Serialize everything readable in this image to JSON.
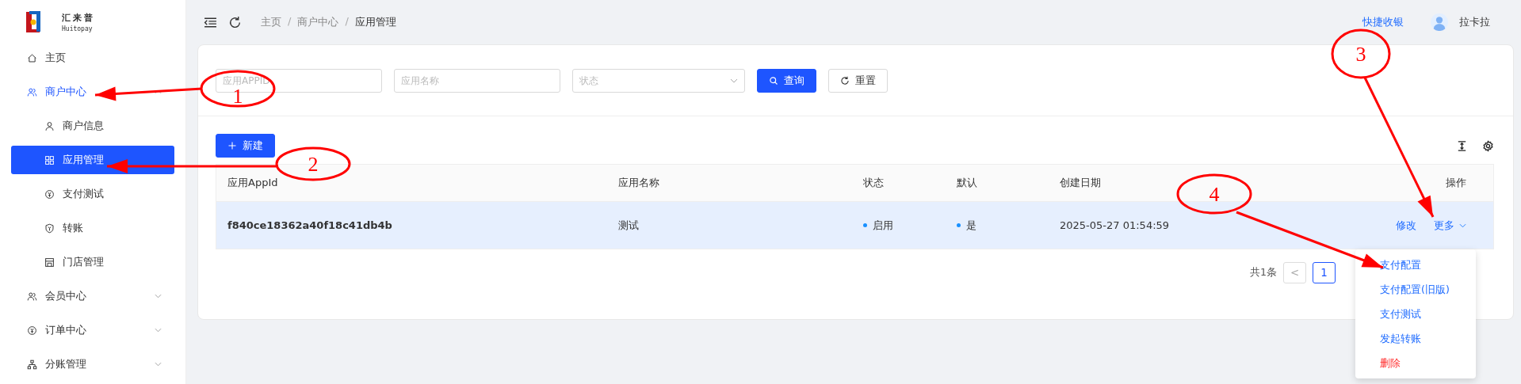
{
  "logo": {
    "name": "汇来普",
    "subtitle": "Huitopay"
  },
  "sidebar": {
    "items": [
      {
        "label": "主页",
        "selected": false
      },
      {
        "label": "商户中心",
        "selected": false,
        "expanded": true,
        "children": [
          {
            "label": "商户信息",
            "selected": false
          },
          {
            "label": "应用管理",
            "selected": true
          },
          {
            "label": "支付测试",
            "selected": false
          },
          {
            "label": "转账",
            "selected": false
          },
          {
            "label": "门店管理",
            "selected": false
          }
        ]
      },
      {
        "label": "会员中心",
        "selected": false,
        "expanded": false
      },
      {
        "label": "订单中心",
        "selected": false,
        "expanded": false
      },
      {
        "label": "分账管理",
        "selected": false,
        "expanded": false
      }
    ]
  },
  "breadcrumb": [
    {
      "kind": "link",
      "text": "主页"
    },
    {
      "kind": "separator",
      "text": "/"
    },
    {
      "kind": "link",
      "text": "商户中心"
    },
    {
      "kind": "separator",
      "text": "/"
    },
    {
      "kind": "current",
      "text": "应用管理"
    }
  ],
  "header": {
    "quick_link": "快捷收银",
    "user": "拉卡拉"
  },
  "filters": [
    {
      "kind": "input",
      "placeholder": "应用APPID"
    },
    {
      "kind": "input",
      "placeholder": "应用名称"
    },
    {
      "kind": "select",
      "placeholder": "状态"
    }
  ],
  "search_button": "查询",
  "reset_button": "重置",
  "new_button": "新建",
  "table": {
    "columns": [
      "应用AppId",
      "应用名称",
      "状态",
      "默认",
      "创建日期",
      "操作"
    ],
    "rows": [
      {
        "app_id": "f840ce18362a40f18c41db4b",
        "name": "测试",
        "status": "启用",
        "default": "是",
        "created": "2025-05-27 01:54:59",
        "edit": "修改",
        "more": "更多",
        "selected": true
      }
    ]
  },
  "pagination": {
    "total": "共1条",
    "prev": "<",
    "page": "1"
  },
  "menu": [
    {
      "label": "支付配置",
      "danger": false
    },
    {
      "label": "支付配置(旧版)",
      "danger": false
    },
    {
      "label": "支付测试",
      "danger": false
    },
    {
      "label": "发起转账",
      "danger": false
    },
    {
      "label": "删除",
      "danger": true
    }
  ],
  "annotations": [
    "1",
    "2",
    "3",
    "4"
  ]
}
